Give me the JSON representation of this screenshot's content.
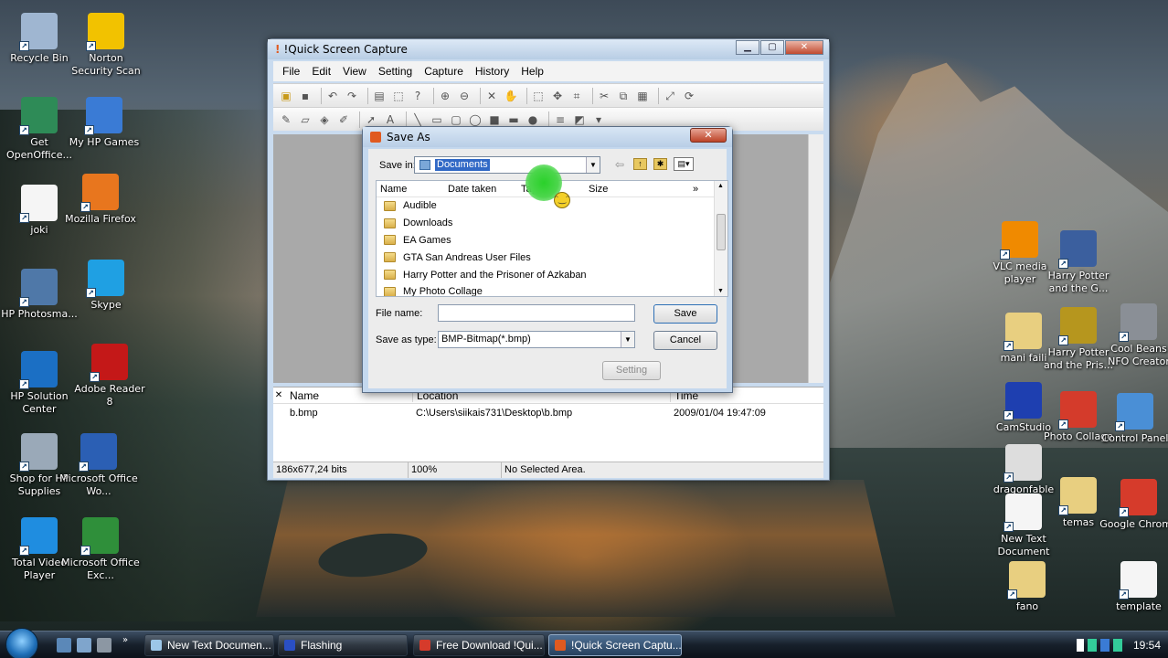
{
  "desktop": {
    "left_icons": [
      {
        "label": "Recycle Bin",
        "icon": "recycle-bin-icon",
        "color": "#9fb6d1"
      },
      {
        "label": "Norton Security Scan",
        "icon": "norton-icon",
        "color": "#f2c200"
      },
      {
        "label": "Get OpenOffice...",
        "icon": "openoffice-icon",
        "color": "#2e8b57"
      },
      {
        "label": "My HP Games",
        "icon": "hp-games-icon",
        "color": "#3a7bd5"
      },
      {
        "label": "joki",
        "icon": "text-file-icon",
        "color": "#f5f5f5"
      },
      {
        "label": "Mozilla Firefox",
        "icon": "firefox-icon",
        "color": "#e8761e"
      },
      {
        "label": "HP Photosma...",
        "icon": "hp-photosmart-icon",
        "color": "#4f78a8"
      },
      {
        "label": "Skype",
        "icon": "skype-icon",
        "color": "#1fa0e3"
      },
      {
        "label": "HP Solution Center",
        "icon": "hp-solution-icon",
        "color": "#1b6fc4"
      },
      {
        "label": "Adobe Reader 8",
        "icon": "adobe-reader-icon",
        "color": "#c41818"
      },
      {
        "label": "Shop for HP Supplies",
        "icon": "hp-shop-icon",
        "color": "#9aa9b8"
      },
      {
        "label": "Microsoft Office Wo...",
        "icon": "word-icon",
        "color": "#2b5fb4"
      },
      {
        "label": "Total Video Player",
        "icon": "video-player-icon",
        "color": "#1f8de0"
      },
      {
        "label": "Microsoft Office Exc...",
        "icon": "excel-icon",
        "color": "#2f8f3a"
      }
    ],
    "right_icons": [
      {
        "label": "VLC media player",
        "icon": "vlc-icon",
        "color": "#f08a00"
      },
      {
        "label": "Harry Potter and the G...",
        "icon": "harry-potter-icon",
        "color": "#3b5f9e"
      },
      {
        "label": "mani faili",
        "icon": "folder-icon",
        "color": "#e8cf80"
      },
      {
        "label": "Harry Potter and the Pris...",
        "icon": "harry-potter-prisoner-icon",
        "color": "#b6961e"
      },
      {
        "label": "Cool Beans NFO Creator",
        "icon": "nfo-creator-icon",
        "color": "#8a8f96"
      },
      {
        "label": "CamStudio",
        "icon": "camstudio-icon",
        "color": "#1e3fb0"
      },
      {
        "label": "Photo Collage",
        "icon": "photo-collage-icon",
        "color": "#d43b2b"
      },
      {
        "label": "Control Panel",
        "icon": "control-panel-icon",
        "color": "#4a8fd6"
      },
      {
        "label": "dragonfable",
        "icon": "dragonfable-icon",
        "color": "#dddddd"
      },
      {
        "label": "New Text Document",
        "icon": "text-file-icon",
        "color": "#f5f5f5"
      },
      {
        "label": "temas",
        "icon": "folder-icon",
        "color": "#e8cf80"
      },
      {
        "label": "Google Chrome",
        "icon": "chrome-icon",
        "color": "#d63b2b"
      },
      {
        "label": "fano",
        "icon": "folder-icon",
        "color": "#e8cf80"
      },
      {
        "label": "template",
        "icon": "text-file-icon",
        "color": "#f5f5f5"
      }
    ]
  },
  "app": {
    "title": "!Quick Screen Capture",
    "menu": [
      "File",
      "Edit",
      "View",
      "Setting",
      "Capture",
      "History",
      "Help"
    ],
    "file_list": {
      "headers": [
        "Name",
        "Location",
        "Time"
      ],
      "rows": [
        {
          "name": "b.bmp",
          "location": "C:\\Users\\siikais731\\Desktop\\b.bmp",
          "time": "2009/01/04 19:47:09"
        }
      ]
    },
    "status": {
      "size": "186x677,24 bits",
      "zoom": "100%",
      "selection": "No Selected Area."
    }
  },
  "dialog": {
    "title": "Save As",
    "save_in_label": "Save in:",
    "save_in_value": "Documents",
    "columns": [
      "Name",
      "Date taken",
      "Tags",
      "Size"
    ],
    "folders": [
      "Audible",
      "Downloads",
      "EA Games",
      "GTA San Andreas User Files",
      "Harry Potter and the Prisoner of Azkaban",
      "My Photo Collage"
    ],
    "file_name_label": "File name:",
    "file_name_value": "",
    "save_as_type_label": "Save as type:",
    "save_as_type_value": "BMP-Bitmap(*.bmp)",
    "save_button": "Save",
    "cancel_button": "Cancel",
    "setting_button": "Setting"
  },
  "taskbar": {
    "buttons": [
      {
        "label": "New Text Documen...",
        "icon": "notepad-icon",
        "color": "#9cc6e8",
        "active": false
      },
      {
        "label": "Flashing",
        "icon": "camstudio-icon",
        "color": "#2a4fc4",
        "active": false
      },
      {
        "label": "Free Download !Qui...",
        "icon": "chrome-icon",
        "color": "#d63b2b",
        "active": false
      },
      {
        "label": "!Quick Screen Captu...",
        "icon": "capture-icon",
        "color": "#e05a20",
        "active": true
      }
    ],
    "clock": "19:54"
  }
}
